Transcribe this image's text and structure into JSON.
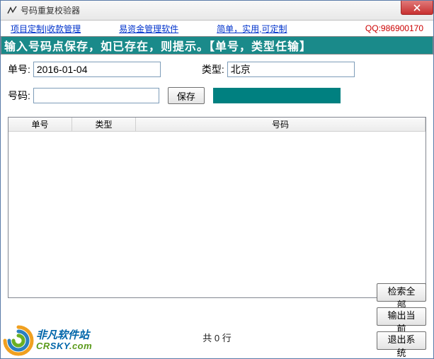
{
  "window": {
    "title": "号码重复校验器"
  },
  "links": {
    "l1": "项目定制|收款管理",
    "l2": "易资金管理软件",
    "l3": "简单，实用,可定制",
    "qq": "QQ:986900170"
  },
  "banner": "输入号码点保存，如已存在，则提示。【单号，类型任输】",
  "form": {
    "danhao_label": "单号:",
    "danhao_value": "2016-01-04",
    "leixing_label": "类型:",
    "leixing_value": "北京",
    "haoma_label": "号码:",
    "haoma_value": "",
    "save_label": "保存"
  },
  "table": {
    "col_danhao": "单号",
    "col_leixing": "类型",
    "col_haoma": "号码"
  },
  "buttons": {
    "search_all": "检索全部",
    "export_current": "输出当前",
    "exit": "退出系统"
  },
  "footer": {
    "count_text": "共 0 行"
  },
  "watermark": {
    "line1": "非凡软件站",
    "line2a": "CR",
    "line2b": "SKY",
    "line2c": ".com"
  }
}
